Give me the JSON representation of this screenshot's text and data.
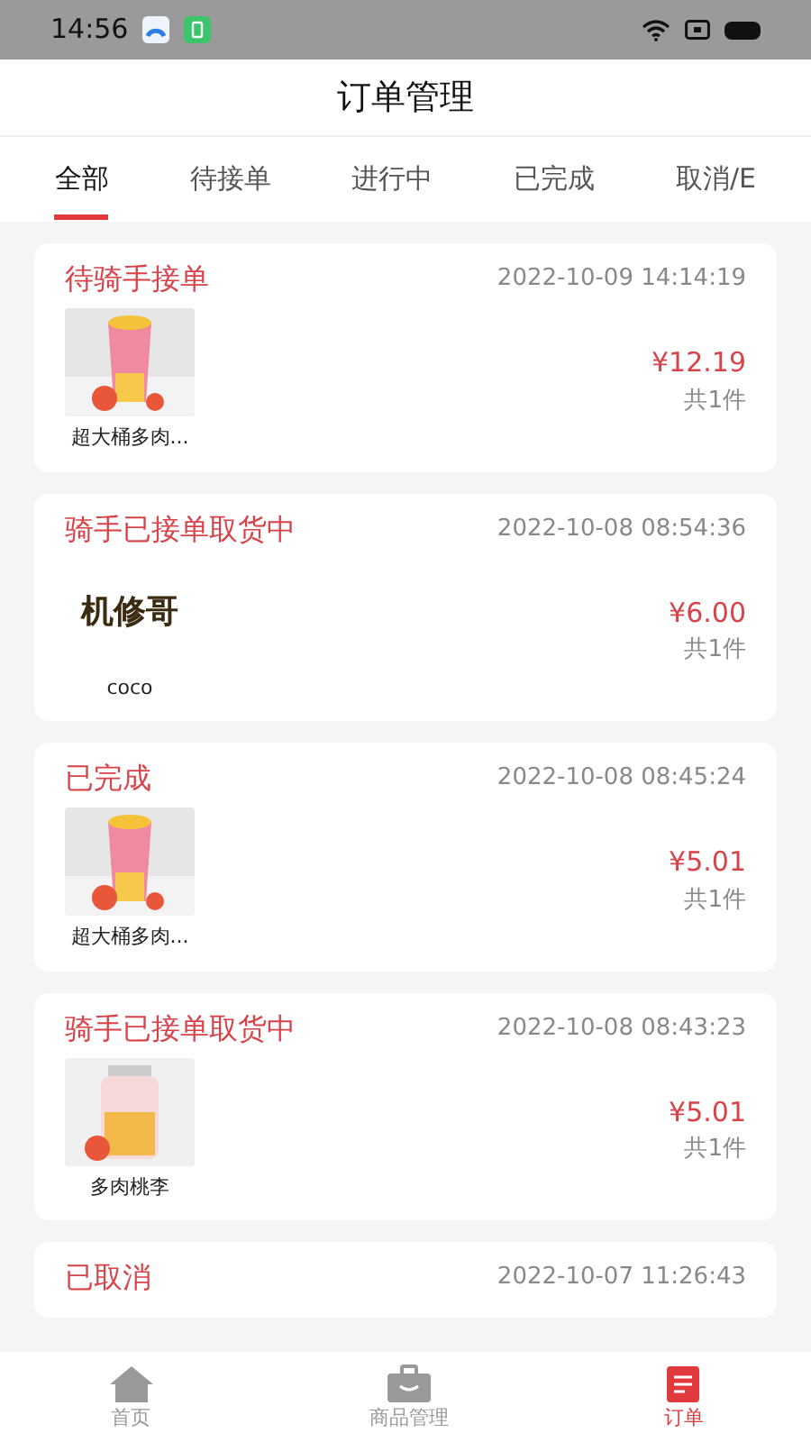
{
  "status_bar": {
    "time": "14:56"
  },
  "header": {
    "title": "订单管理"
  },
  "tabs": [
    {
      "label": "全部",
      "selected": true
    },
    {
      "label": "待接单",
      "selected": false
    },
    {
      "label": "进行中",
      "selected": false
    },
    {
      "label": "已完成",
      "selected": false
    },
    {
      "label": "取消/E",
      "selected": false
    }
  ],
  "orders": [
    {
      "status": "待骑手接单",
      "time": "2022-10-09 14:14:19",
      "item": {
        "kind": "photo",
        "name": "超大桶多肉..."
      },
      "price": "¥12.19",
      "count": "共1件"
    },
    {
      "status": "骑手已接单取货中",
      "time": "2022-10-08 08:54:36",
      "item": {
        "kind": "logo",
        "logo_text": "机修哥",
        "name": "coco"
      },
      "price": "¥6.00",
      "count": "共1件"
    },
    {
      "status": "已完成",
      "time": "2022-10-08 08:45:24",
      "item": {
        "kind": "photo",
        "name": "超大桶多肉..."
      },
      "price": "¥5.01",
      "count": "共1件"
    },
    {
      "status": "骑手已接单取货中",
      "time": "2022-10-08 08:43:23",
      "item": {
        "kind": "bottle",
        "name": "多肉桃李"
      },
      "price": "¥5.01",
      "count": "共1件"
    },
    {
      "status": "已取消",
      "time": "2022-10-07 11:26:43"
    }
  ],
  "bottom_nav": [
    {
      "label": "首页",
      "kind": "home",
      "selected": false
    },
    {
      "label": "商品管理",
      "kind": "bag",
      "selected": false
    },
    {
      "label": "订单",
      "kind": "list",
      "selected": true
    }
  ]
}
